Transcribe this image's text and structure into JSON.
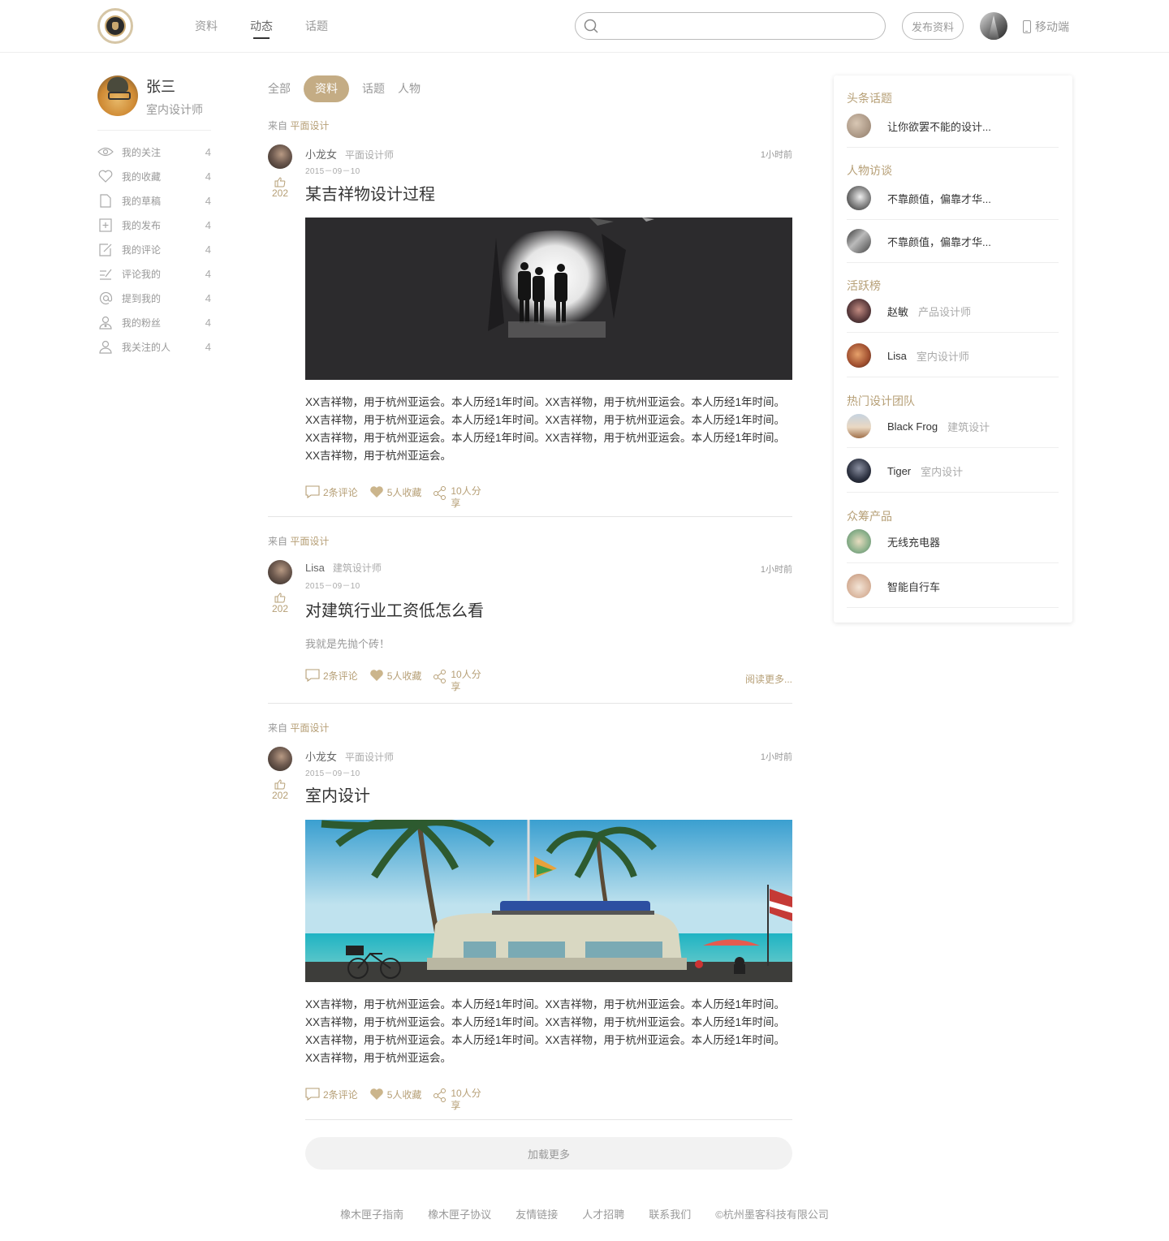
{
  "header": {
    "nav": [
      "资料",
      "动态",
      "话题"
    ],
    "active_nav": "动态",
    "search_value": "",
    "publish_label": "发布资料",
    "mobile_label": "移动端"
  },
  "profile": {
    "name": "张三",
    "title": "室内设计师"
  },
  "menu": [
    {
      "label": "我的关注",
      "count": "4",
      "icon": "eye-icon"
    },
    {
      "label": "我的收藏",
      "count": "4",
      "icon": "heart-icon"
    },
    {
      "label": "我的草稿",
      "count": "4",
      "icon": "document-icon"
    },
    {
      "label": "我的发布",
      "count": "4",
      "icon": "add-document-icon"
    },
    {
      "label": "我的评论",
      "count": "4",
      "icon": "edit-icon"
    },
    {
      "label": "评论我的",
      "count": "4",
      "icon": "comment-edit-icon"
    },
    {
      "label": "提到我的",
      "count": "4",
      "icon": "at-icon"
    },
    {
      "label": "我的粉丝",
      "count": "4",
      "icon": "fans-icon"
    },
    {
      "label": "我关注的人",
      "count": "4",
      "icon": "user-icon"
    }
  ],
  "tabs": [
    "全部",
    "资料",
    "话题",
    "人物"
  ],
  "active_tab": "资料",
  "posts": [
    {
      "from_prefix": "来自",
      "from_category": "平面设计",
      "author": "小龙女",
      "role": "平面设计师",
      "date": "2015－09－10",
      "time": "1小时前",
      "likes": "202",
      "title": "某吉祥物设计过程",
      "text": "XX吉祥物，用于杭州亚运会。本人历经1年时间。XX吉祥物，用于杭州亚运会。本人历经1年时间。XX吉祥物，用于杭州亚运会。本人历经1年时间。XX吉祥物，用于杭州亚运会。本人历经1年时间。XX吉祥物，用于杭州亚运会。本人历经1年时间。XX吉祥物，用于杭州亚运会。本人历经1年时间。XX吉祥物，用于杭州亚运会。",
      "comments": "2条评论",
      "favorites": "5人收藏",
      "shares": "10人分享"
    },
    {
      "from_prefix": "来自",
      "from_category": "平面设计",
      "author": "Lisa",
      "role": "建筑设计师",
      "date": "2015－09－10",
      "time": "1小时前",
      "likes": "202",
      "title": "对建筑行业工资低怎么看",
      "text": "我就是先抛个砖！",
      "comments": "2条评论",
      "favorites": "5人收藏",
      "shares": "10人分享",
      "read_more": "阅读更多..."
    },
    {
      "from_prefix": "来自",
      "from_category": "平面设计",
      "author": "小龙女",
      "role": "平面设计师",
      "date": "2015－09－10",
      "time": "1小时前",
      "likes": "202",
      "title": "室内设计",
      "text": "XX吉祥物，用于杭州亚运会。本人历经1年时间。XX吉祥物，用于杭州亚运会。本人历经1年时间。XX吉祥物，用于杭州亚运会。本人历经1年时间。XX吉祥物，用于杭州亚运会。本人历经1年时间。XX吉祥物，用于杭州亚运会。本人历经1年时间。XX吉祥物，用于杭州亚运会。本人历经1年时间。XX吉祥物，用于杭州亚运会。",
      "comments": "2条评论",
      "favorites": "5人收藏",
      "shares": "10人分享"
    }
  ],
  "load_more": "加载更多",
  "right": {
    "headline_title": "头条话题",
    "headline_items": [
      {
        "text": "让你欲罢不能的设计..."
      }
    ],
    "interview_title": "人物访谈",
    "interview_items": [
      {
        "text": "不靠颜值，偏靠才华..."
      },
      {
        "text": "不靠颜值，偏靠才华..."
      }
    ],
    "active_title": "活跃榜",
    "active_items": [
      {
        "name": "赵敏",
        "sub": "产品设计师"
      },
      {
        "name": "Lisa",
        "sub": "室内设计师"
      }
    ],
    "teams_title": "热门设计团队",
    "team_items": [
      {
        "name": "Black Frog",
        "sub": "建筑设计"
      },
      {
        "name": "Tiger",
        "sub": "室内设计"
      }
    ],
    "crowd_title": "众筹产品",
    "crowd_items": [
      {
        "text": "无线充电器"
      },
      {
        "text": "智能自行车"
      }
    ]
  },
  "footer": [
    "橡木匣子指南",
    "橡木匣子协议",
    "友情链接",
    "人才招聘",
    "联系我们",
    "©杭州墨客科技有限公司"
  ],
  "colors": {
    "accent": "#b69f76",
    "tab_active_bg": "#c4ac84"
  }
}
